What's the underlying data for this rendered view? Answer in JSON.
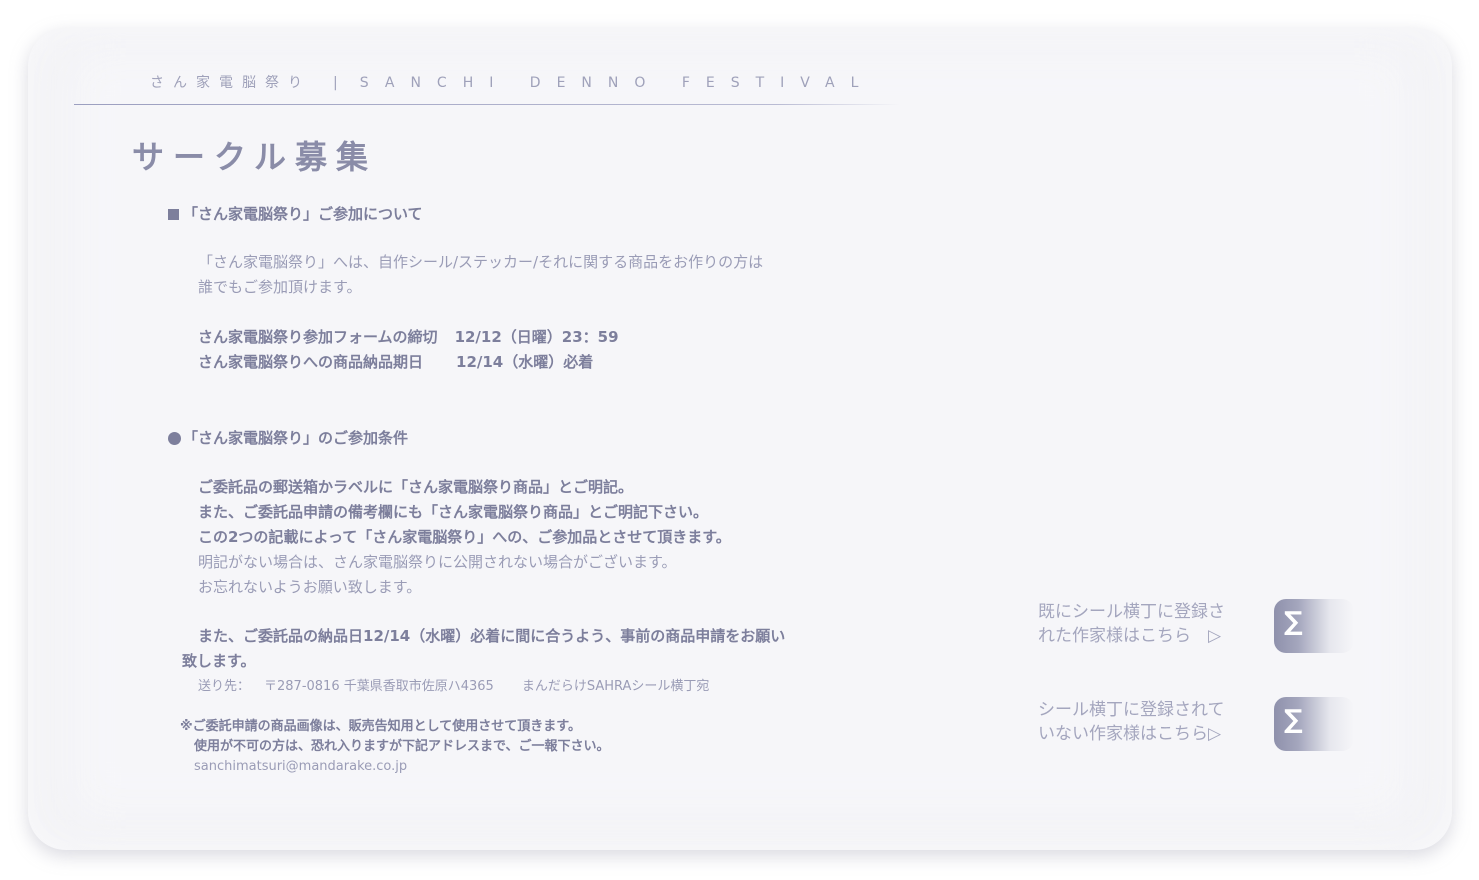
{
  "header": {
    "site_title_jp": "さん家電脳祭り",
    "separator": "|",
    "site_title_en": "SANCHI DENNO FESTIVAL"
  },
  "page_title": "サークル募集",
  "section1": {
    "heading": "「さん家電脳祭り」ご参加について",
    "intro_line1": "「さん家電脳祭り」へは、自作シール/ステッカー/それに関する商品をお作りの方は",
    "intro_line2": "誰でもご参加頂けます。",
    "deadline1_label": "さん家電脳祭り参加フォームの締切",
    "deadline1_value": "12/12（日曜）23：59",
    "deadline2_label": "さん家電脳祭りへの商品納品期日",
    "deadline2_value": "12/14（水曜）必着"
  },
  "section2": {
    "heading": "「さん家電脳祭り」のご参加条件",
    "line1": "ご委託品の郵送箱かラベルに「さん家電脳祭り商品」とご明記。",
    "line2": "また、ご委託品申請の備考欄にも「さん家電脳祭り商品」とご明記下さい。",
    "line3": "この2つの記載によって「さん家電脳祭り」への、ご参加品とさせて頂きます。",
    "line4": "明記がない場合は、さん家電脳祭りに公開されない場合がございます。",
    "line5": "お忘れないようお願い致します。",
    "line6": "また、ご委託品の納品日12/14（水曜）必着に間に合うよう、事前の商品申請をお願い",
    "line7": "致します。",
    "address_label": "送り先：",
    "address_value": "〒287-0816 千葉県香取市佐原ハ4365",
    "address_recipient": "まんだらけSAHRAシール横丁宛",
    "note_line1": "※ご委託申請の商品画像は、販売告知用として使用させて頂きます。",
    "note_line2": "使用が不可の方は、恐れ入りますが下記アドレスまで、ご一報下さい。",
    "email": "sanchimatsuri@mandarake.co.jp"
  },
  "side_links": [
    {
      "line1": "既にシール横丁に登録さ",
      "line2": "れた作家様はこちら　▷",
      "button_glyph": "∑"
    },
    {
      "line1": "シール横丁に登録されて",
      "line2": "いない作家様はこちら▷",
      "button_glyph": "∑"
    }
  ],
  "colors": {
    "card_bg": "#f3f3f6",
    "text_primary": "#7d7f9c",
    "text_light": "#9a9cb6"
  }
}
